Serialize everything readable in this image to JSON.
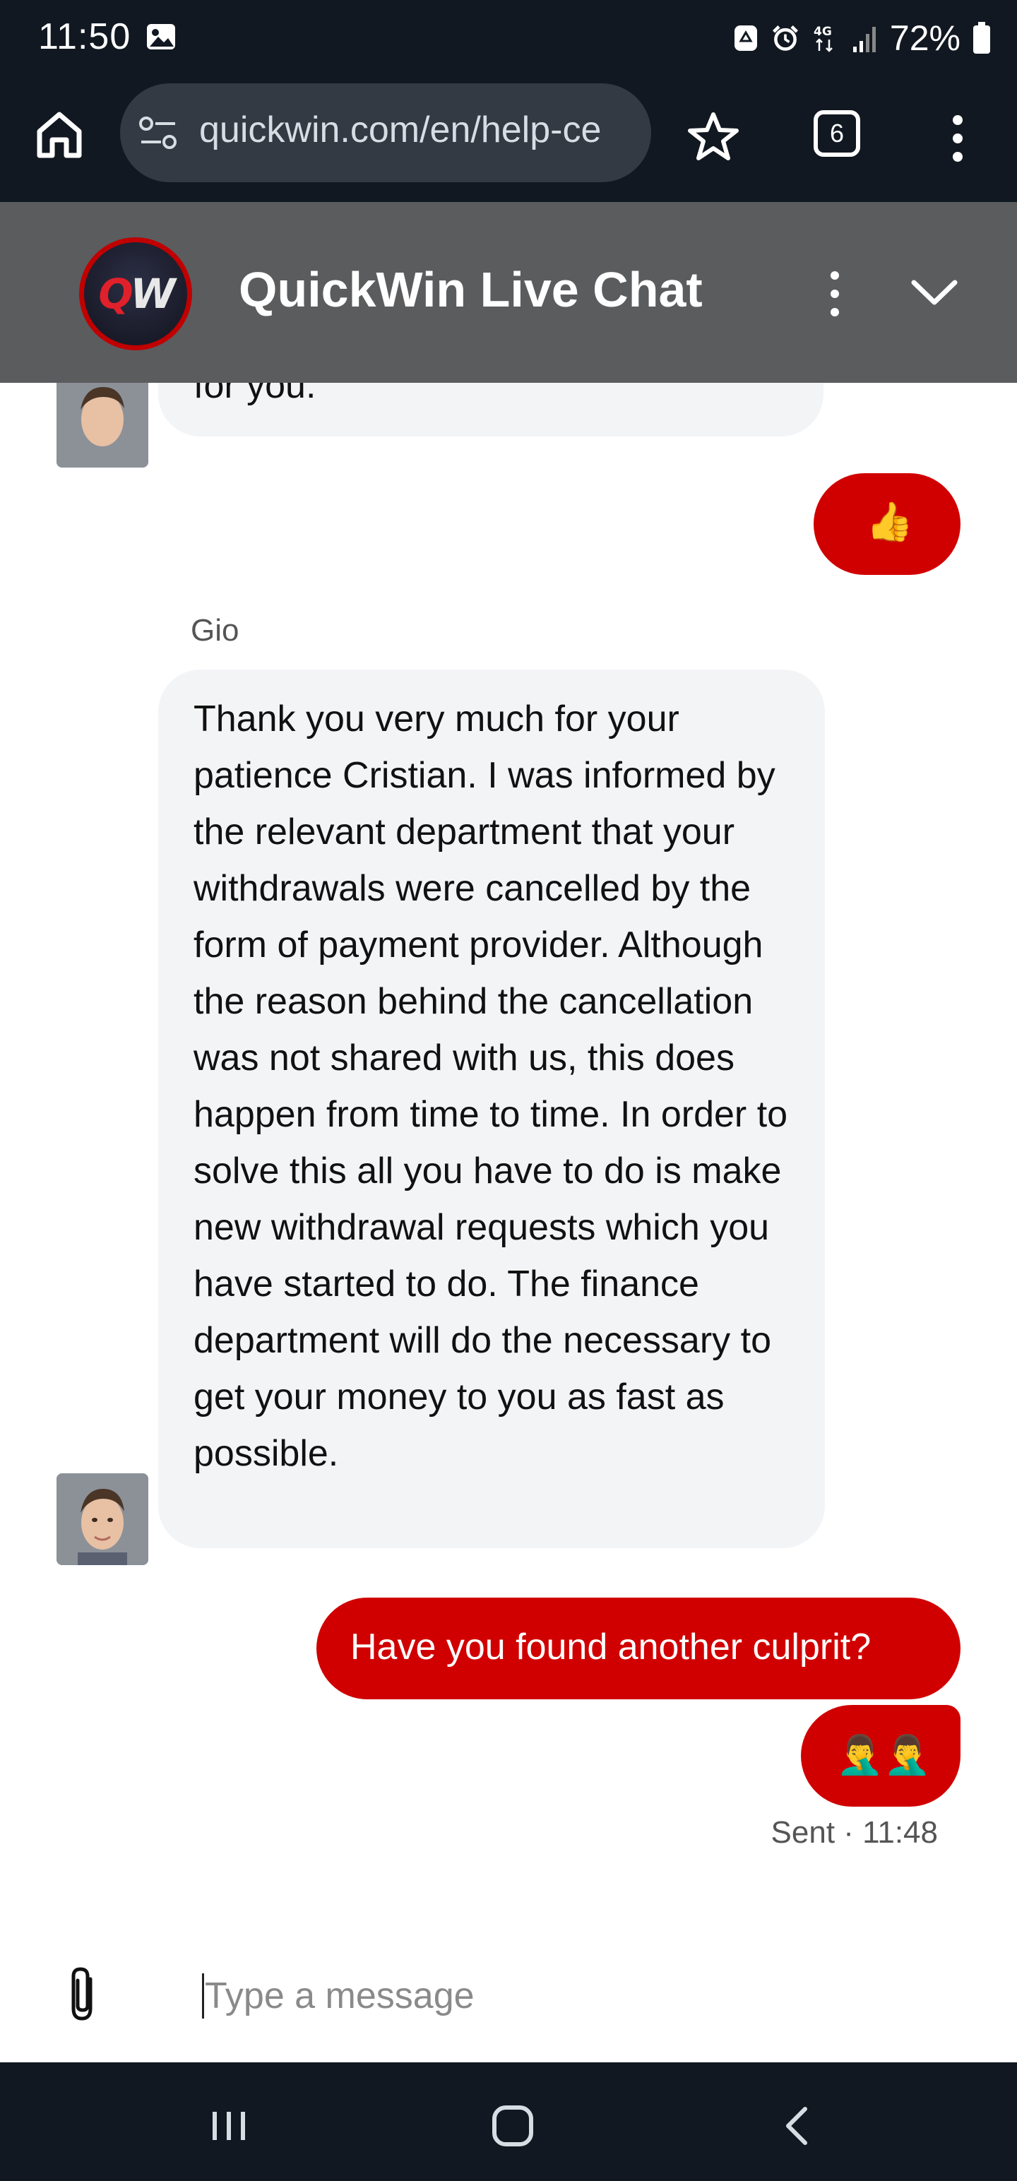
{
  "status_bar": {
    "time": "11:50",
    "battery": "72%",
    "icons": [
      "image-icon",
      "recycle-icon",
      "alarm-icon",
      "4g-icon",
      "signal-icon",
      "battery-icon"
    ]
  },
  "browser": {
    "url": "quickwin.com/en/help-ce",
    "tab_count": "6"
  },
  "chat_header": {
    "title": "QuickWin Live Chat",
    "logo_text_q": "Q",
    "logo_text_w": "W"
  },
  "messages": {
    "truncated_agent_tail": "for you.",
    "user_thumbs": "👍",
    "agent_name": "Gio",
    "agent_message": "Thank you very much for your patience  Cristian. I was informed by the relevant department that your withdrawals were cancelled by the form of payment provider. Although the reason behind the cancellation was not shared with us, this does happen from time to time. In order to solve this all you have to do is make new withdrawal requests which you have started to do. The finance department will do the necessary to get your money to you as fast as possible.",
    "user_question": "Have you found another culprit?",
    "user_facepalm": "🤦‍♂️🤦‍♂️",
    "sent_status": "Sent · 11:48"
  },
  "input": {
    "placeholder": "Type a message"
  },
  "colors": {
    "brand_red": "#d10000",
    "header_gray": "#5b5c5e",
    "system_dark": "#111821",
    "agent_bubble": "#f3f4f6"
  }
}
